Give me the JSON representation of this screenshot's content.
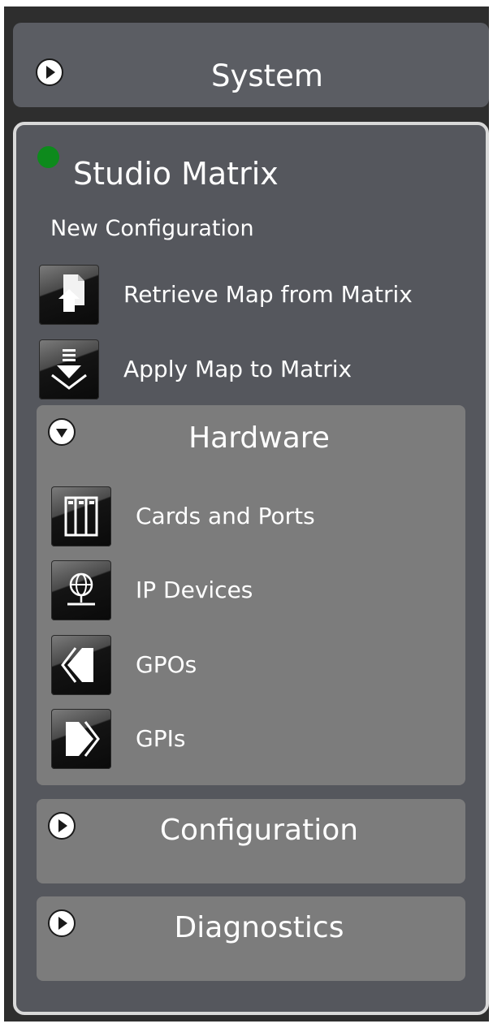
{
  "system": {
    "title": "System",
    "expander_icon": "expand-arrow-icon"
  },
  "panel": {
    "status_color": "#0d8a1c",
    "title": "Studio Matrix",
    "configuration_name": "New Configuration",
    "actions": [
      {
        "label": "Retrieve Map from Matrix",
        "icon": "retrieve-map-icon"
      },
      {
        "label": "Apply Map to Matrix",
        "icon": "apply-map-icon"
      }
    ],
    "sections": {
      "hardware": {
        "title": "Hardware",
        "expanded": true,
        "items": [
          {
            "label": "Cards and Ports",
            "icon": "cards-ports-icon"
          },
          {
            "label": "IP Devices",
            "icon": "ip-devices-icon"
          },
          {
            "label": "GPOs",
            "icon": "gpo-icon"
          },
          {
            "label": "GPIs",
            "icon": "gpi-icon"
          }
        ]
      },
      "configuration": {
        "title": "Configuration",
        "expanded": false
      },
      "diagnostics": {
        "title": "Diagnostics",
        "expanded": false
      }
    }
  },
  "colors": {
    "background": "#2e2e2e",
    "panel": "#55575d",
    "section": "#7c7c7c",
    "text": "#ffffff"
  }
}
